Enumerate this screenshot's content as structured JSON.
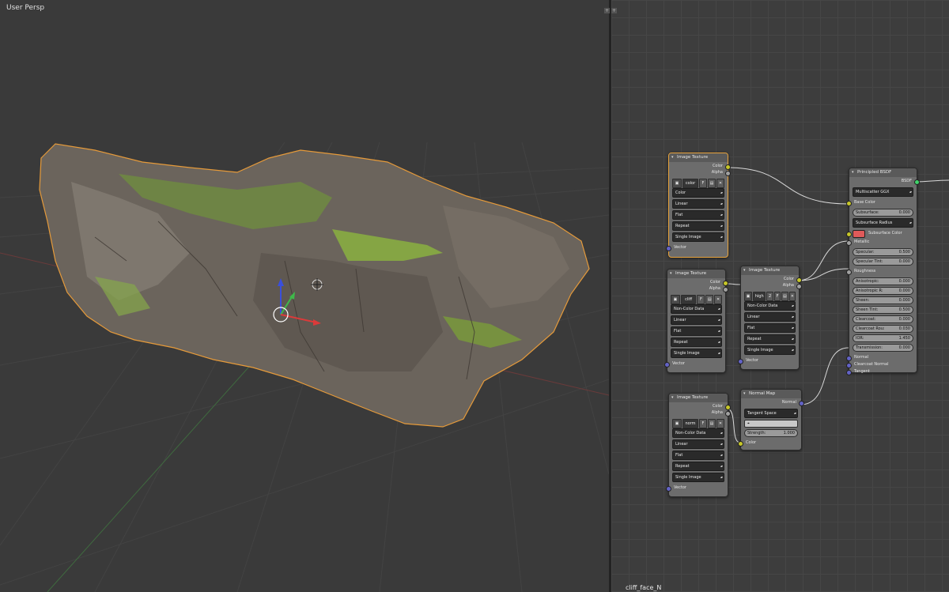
{
  "viewport": {
    "label": "User Persp"
  },
  "corner": {
    "plus1": "+",
    "plus2": "+"
  },
  "node_editor": {
    "material_name": "cliff_face_N"
  },
  "node_color": {
    "title": "Image Texture",
    "out_color": "Color",
    "out_alpha": "Alpha",
    "image_name": "color",
    "image_flag": "F",
    "color_space": "Color",
    "interpolation": "Linear",
    "projection": "Flat",
    "extension": "Repeat",
    "source": "Single Image",
    "in_vector": "Vector"
  },
  "node_cliff": {
    "title": "Image Texture",
    "out_color": "Color",
    "out_alpha": "Alpha",
    "image_name": "cliff",
    "image_flag": "F",
    "color_space": "Non-Color Data",
    "interpolation": "Linear",
    "projection": "Flat",
    "extension": "Repeat",
    "source": "Single Image",
    "in_vector": "Vector"
  },
  "node_high": {
    "title": "Image Texture",
    "out_color": "Color",
    "out_alpha": "Alpha",
    "image_name": "high",
    "image_users": "2",
    "image_flag": "F",
    "color_space": "Non-Color Data",
    "interpolation": "Linear",
    "projection": "Flat",
    "extension": "Repeat",
    "source": "Single Image",
    "in_vector": "Vector"
  },
  "node_norm": {
    "title": "Image Texture",
    "out_color": "Color",
    "out_alpha": "Alpha",
    "image_name": "norm",
    "image_flag": "F",
    "color_space": "Non-Color Data",
    "interpolation": "Linear",
    "projection": "Flat",
    "extension": "Repeat",
    "source": "Single Image",
    "in_vector": "Vector"
  },
  "node_normalmap": {
    "title": "Normal Map",
    "out_normal": "Normal",
    "space": "Tangent Space",
    "uv_icon": "uv-map-icon",
    "strength_label": "Strength:",
    "strength_value": "1.000",
    "in_color": "Color"
  },
  "node_bsdf": {
    "title": "Principled BSDF",
    "out_bsdf": "BSDF",
    "distribution": "Multiscatter GGX",
    "base_color": "Base Color",
    "subsurface_label": "Subsurface:",
    "subsurface_value": "0.000",
    "subsurface_radius": "Subsurface Radius",
    "subsurface_color": "Subsurface Color",
    "subsurface_color_hex": "#e05a5a",
    "metallic": "Metallic",
    "specular_label": "Specular:",
    "specular_value": "0.500",
    "specular_tint_label": "Specular Tint:",
    "specular_tint_value": "0.000",
    "roughness": "Roughness",
    "anisotropic_label": "Anisotropic:",
    "anisotropic_value": "0.000",
    "anisotropic_r_label": "Anisotropic R:",
    "anisotropic_r_value": "0.000",
    "sheen_label": "Sheen:",
    "sheen_value": "0.000",
    "sheen_tint_label": "Sheen Tint:",
    "sheen_tint_value": "0.500",
    "clearcoat_label": "Clearcoat:",
    "clearcoat_value": "0.000",
    "clearcoat_rough_label": "Clearcoat Rou:",
    "clearcoat_rough_value": "0.030",
    "ior_label": "IOR:",
    "ior_value": "1.450",
    "transmission_label": "Transmission:",
    "transmission_value": "0.000",
    "normal": "Normal",
    "clearcoat_normal": "Clearcoat Normal",
    "tangent": "Tangent"
  }
}
